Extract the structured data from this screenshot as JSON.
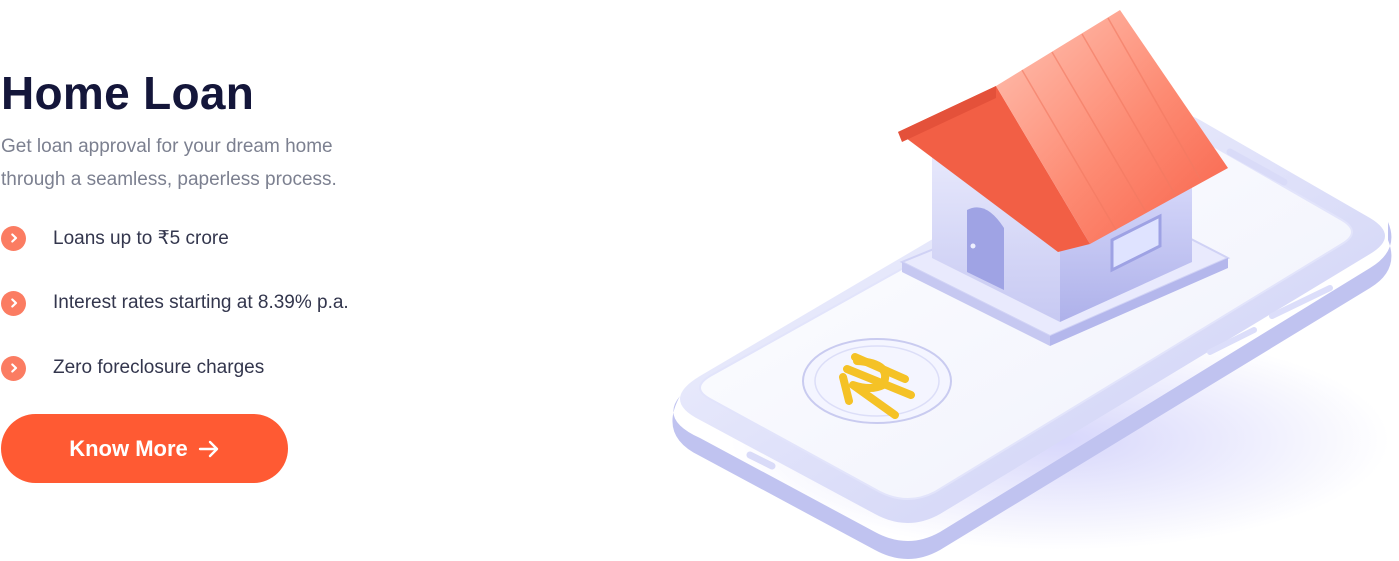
{
  "hero": {
    "title": "Home Loan",
    "subtitle": "Get loan approval for your dream home through a seamless, paperless process.",
    "features": [
      {
        "label": "Loans up to ₹5 crore",
        "icon": "chevron-right-icon"
      },
      {
        "label": "Interest rates starting at 8.39% p.a.",
        "icon": "chevron-right-icon"
      },
      {
        "label": "Zero foreclosure charges",
        "icon": "chevron-right-icon"
      }
    ],
    "cta": {
      "label": "Know More",
      "icon": "arrow-right-icon"
    }
  },
  "illustration": {
    "subject": "house-on-phone-illustration",
    "coin_symbol": "rupee-icon"
  },
  "colors": {
    "title": "#14163a",
    "subtitle": "#7c8090",
    "feature_text": "#33364d",
    "bullet": "#fb7c62",
    "cta_background": "#ff5a33",
    "cta_text": "#ffffff",
    "roof": "#fd7a64",
    "coin": "#f5c226"
  }
}
